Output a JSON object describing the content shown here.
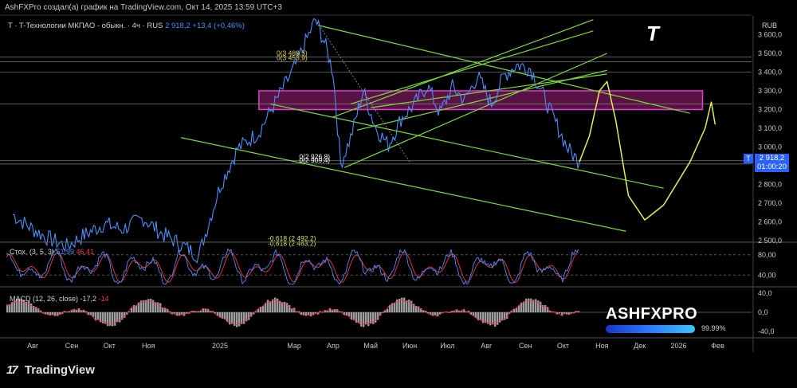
{
  "header": {
    "caption": "AshFXPro создал(а) график на TradingView.com, Окт 14, 2025 13:59 UTC+3"
  },
  "legend": {
    "symbol": "T · T-Технологии МКПАО - обыкн. · 4ч · RUS",
    "price": "2 918,2",
    "change": "+13,4 (+0,46%)"
  },
  "ticker_badge": "T",
  "currency": "RUB",
  "current_price": {
    "marker": "T",
    "value": "2 918,2",
    "countdown": "01:00:20"
  },
  "fib_labels": [
    {
      "text": "0(3 489,5)",
      "price": 3480
    },
    {
      "text": "0(3 453,9)",
      "price": 3455
    },
    {
      "text": "0(2 926,8)",
      "price": 2926.8
    },
    {
      "text": "0(2 909,4)",
      "price": 2909.4
    },
    {
      "text": "-0,618 (2 492,2)",
      "price": 2492.2
    },
    {
      "text": "-0,618 (2 463,2)",
      "price": 2463.2
    }
  ],
  "indicators": {
    "stoch": {
      "label": "Стох. (3, 5, 3)",
      "v1": "51,99",
      "v2": "46,41"
    },
    "macd": {
      "label": "MACD (12, 26, close)",
      "v1": "-17,2",
      "v2": "-14"
    }
  },
  "watermark": {
    "text": "ASHFXPRO",
    "percent": "99.99%"
  },
  "brand": {
    "logo": "17",
    "name": "TradingView"
  },
  "colors": {
    "price_line": "#4f8df6",
    "channel": "#7ddc3a",
    "zone_fill": "#a0207c",
    "zone_border": "#e040d0",
    "projection": "#e6ec5a",
    "stoch_k": "#4f8df6",
    "stoch_d": "#f23645",
    "macd_hist": "#9e9e9e",
    "macd_line": "#f23645"
  },
  "chart_data": {
    "type": "line",
    "title": "T · T-Технологии МКПАО - обыкн. · 4ч · RUS",
    "xlabel": "",
    "ylabel": "RUB",
    "x_ticks": [
      "Авг",
      "Сен",
      "Окт",
      "Ноя",
      "2025",
      "Мар",
      "Апр",
      "Май",
      "Июн",
      "Июл",
      "Авг",
      "Сен",
      "Окт",
      "Ноя",
      "Дек",
      "2026",
      "Фев"
    ],
    "price_panel": {
      "ylim": [
        2500,
        3700
      ],
      "y_ticks": [
        "2 500,0",
        "2 600,0",
        "2 700,0",
        "2 800,0",
        "2 900,0",
        "3 000,0",
        "3 100,0",
        "3 200,0",
        "3 300,0",
        "3 400,0",
        "3 500,0",
        "3 600,0"
      ],
      "y_tick_values": [
        2500,
        2600,
        2700,
        2800,
        2900,
        3000,
        3100,
        3200,
        3300,
        3400,
        3500,
        3600
      ],
      "series": [
        {
          "values": [
            [
              "2024-07-20",
              2640
            ],
            [
              "2024-08-01",
              2580
            ],
            [
              "2024-08-15",
              2520
            ],
            [
              "2024-09-01",
              2470
            ],
            [
              "2024-09-15",
              2530
            ],
            [
              "2024-10-01",
              2590
            ],
            [
              "2024-10-15",
              2560
            ],
            [
              "2024-11-01",
              2620
            ],
            [
              "2024-11-15",
              2540
            ],
            [
              "2024-12-01",
              2480
            ],
            [
              "2024-12-15",
              2420
            ],
            [
              "2025-01-01",
              2790
            ],
            [
              "2025-01-15",
              2990
            ],
            [
              "2025-02-01",
              3080
            ],
            [
              "2025-02-15",
              3250
            ],
            [
              "2025-03-01",
              3420
            ],
            [
              "2025-03-10",
              3560
            ],
            [
              "2025-03-18",
              3680
            ],
            [
              "2025-03-25",
              3560
            ],
            [
              "2025-04-01",
              3400
            ],
            [
              "2025-04-07",
              2910
            ],
            [
              "2025-04-15",
              3050
            ],
            [
              "2025-04-25",
              3300
            ],
            [
              "2025-05-05",
              3100
            ],
            [
              "2025-05-15",
              3010
            ],
            [
              "2025-05-25",
              3150
            ],
            [
              "2025-06-05",
              3230
            ],
            [
              "2025-06-15",
              3330
            ],
            [
              "2025-06-25",
              3180
            ],
            [
              "2025-07-05",
              3320
            ],
            [
              "2025-07-15",
              3250
            ],
            [
              "2025-07-25",
              3380
            ],
            [
              "2025-08-05",
              3230
            ],
            [
              "2025-08-15",
              3380
            ],
            [
              "2025-08-25",
              3440
            ],
            [
              "2025-09-05",
              3420
            ],
            [
              "2025-09-15",
              3280
            ],
            [
              "2025-09-25",
              3130
            ],
            [
              "2025-10-05",
              2990
            ],
            [
              "2025-10-14",
              2918
            ]
          ]
        }
      ],
      "horizontal_levels": [
        3480,
        3455,
        3400,
        3230,
        2926.8,
        2909.4,
        2492.2
      ],
      "zone": {
        "from_date": "2025-02-01",
        "to_date": "2026-01-20",
        "low": 3200,
        "high": 3300
      },
      "projection": {
        "values": [
          [
            "2025-10-14",
            2920
          ],
          [
            "2025-10-22",
            3060
          ],
          [
            "2025-10-30",
            3300
          ],
          [
            "2025-11-05",
            3350
          ],
          [
            "2025-11-12",
            3140
          ],
          [
            "2025-11-22",
            2740
          ],
          [
            "2025-12-05",
            2610
          ],
          [
            "2025-12-20",
            2690
          ],
          [
            "2026-01-10",
            2920
          ],
          [
            "2026-01-22",
            3100
          ],
          [
            "2026-01-27",
            3240
          ],
          [
            "2026-01-30",
            3120
          ]
        ]
      }
    },
    "stoch_panel": {
      "ylim": [
        20,
        100
      ],
      "y_ticks": [
        "80,00",
        "40,00"
      ],
      "y_tick_values": [
        80,
        40
      ],
      "series": [
        {
          "name": "K",
          "value": 51.99
        },
        {
          "name": "D",
          "value": 46.41
        }
      ]
    },
    "macd_panel": {
      "ylim": [
        -50,
        50
      ],
      "y_ticks": [
        "40,0",
        "0,0",
        "-40,0"
      ],
      "y_tick_values": [
        40,
        0,
        -40
      ],
      "series": [
        {
          "name": "MACD",
          "value": -17.2
        },
        {
          "name": "Signal",
          "value": -14
        }
      ]
    }
  }
}
